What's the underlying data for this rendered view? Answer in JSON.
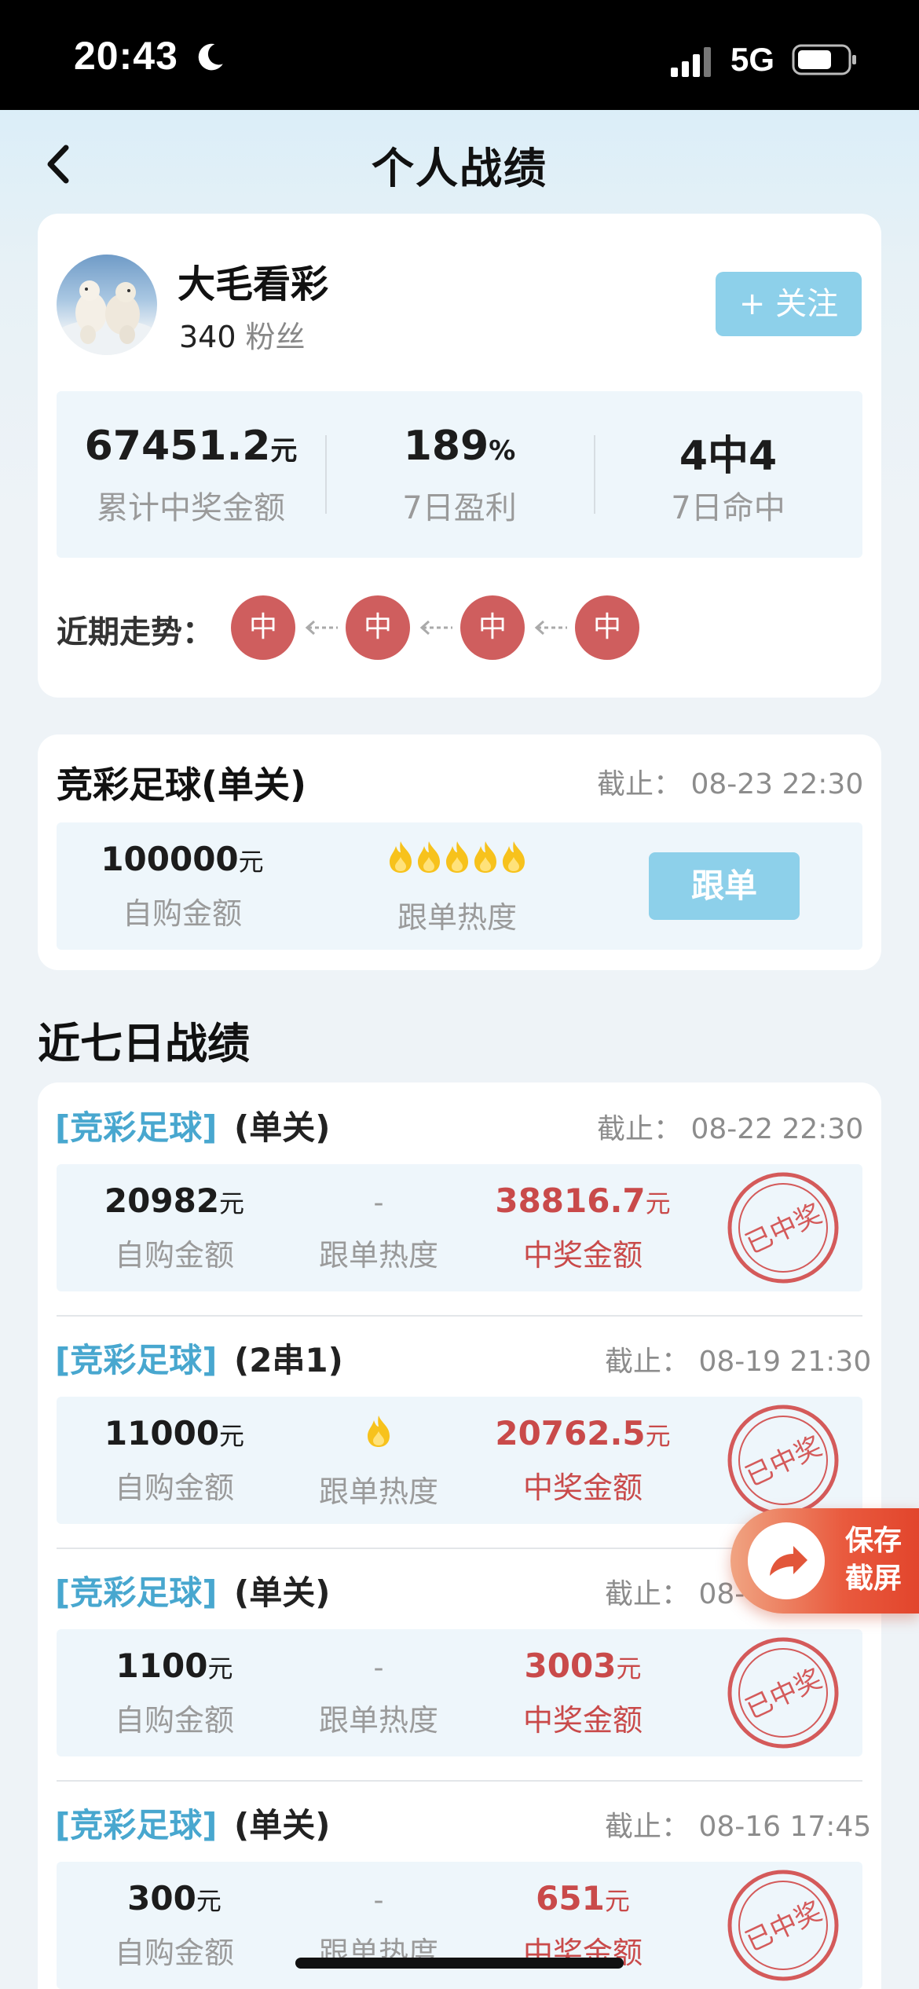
{
  "status_bar": {
    "time": "20:43",
    "network": "5G"
  },
  "header": {
    "title": "个人战绩"
  },
  "profile": {
    "name": "大毛看彩",
    "fans_count": "340",
    "fans_unit": "粉丝",
    "follow_label": "+ 关注"
  },
  "stats": [
    {
      "value": "67451.2",
      "unit": "元",
      "label": "累计中奖金额"
    },
    {
      "value": "189",
      "unit": "%",
      "label": "7日盈利"
    },
    {
      "value": "4中4",
      "unit": "",
      "label": "7日命中"
    }
  ],
  "trend": {
    "label": "近期走势：",
    "items": [
      "中",
      "中",
      "中",
      "中"
    ]
  },
  "current_pick": {
    "title": "竞彩足球(单关)",
    "deadline": "截止：  08-23 22:30",
    "amount": "100000",
    "amount_unit": "元",
    "amount_label": "自购金额",
    "heat_label": "跟单热度",
    "heat_level": 5,
    "follow_button": "跟单"
  },
  "section": {
    "title": "近七日战绩"
  },
  "records": [
    {
      "category": "[竞彩足球]",
      "type": "(单关)",
      "deadline": "截止：  08-22 22:30",
      "amount": "20982",
      "unit": "元",
      "amount_label": "自购金额",
      "heat": "-",
      "heat_level": 0,
      "heat_label": "跟单热度",
      "prize": "38816.7",
      "prize_unit": "元",
      "prize_label": "中奖金额",
      "stamp": "已中奖"
    },
    {
      "category": "[竞彩足球]",
      "type": "(2串1)",
      "deadline": "截止：  08-19 21:30",
      "amount": "11000",
      "unit": "元",
      "amount_label": "自购金额",
      "heat": "",
      "heat_level": 1,
      "heat_label": "跟单热度",
      "prize": "20762.5",
      "prize_unit": "元",
      "prize_label": "中奖金额",
      "stamp": "已中奖"
    },
    {
      "category": "[竞彩足球]",
      "type": "(单关)",
      "deadline": "截止：  08-",
      "amount": "1100",
      "unit": "元",
      "amount_label": "自购金额",
      "heat": "-",
      "heat_level": 0,
      "heat_label": "跟单热度",
      "prize": "3003",
      "prize_unit": "元",
      "prize_label": "中奖金额",
      "stamp": "已中奖"
    },
    {
      "category": "[竞彩足球]",
      "type": "(单关)",
      "deadline": "截止：  08-16 17:45",
      "amount": "300",
      "unit": "元",
      "amount_label": "自购金额",
      "heat": "-",
      "heat_level": 0,
      "heat_label": "跟单热度",
      "prize": "651",
      "prize_unit": "元",
      "prize_label": "中奖金额",
      "stamp": "已中奖"
    }
  ],
  "save_float": {
    "line1": "保存",
    "line2": "截屏"
  },
  "colors": {
    "accent": "#8dd0ea",
    "win_red": "#c94a4a",
    "trend_red": "#cf5e5e",
    "category_blue": "#48a7cf"
  },
  "icons": [
    "back-icon",
    "moon-icon",
    "signal-icon",
    "battery-icon",
    "flame-icon",
    "share-arrow-icon",
    "winning-stamp-icon"
  ]
}
